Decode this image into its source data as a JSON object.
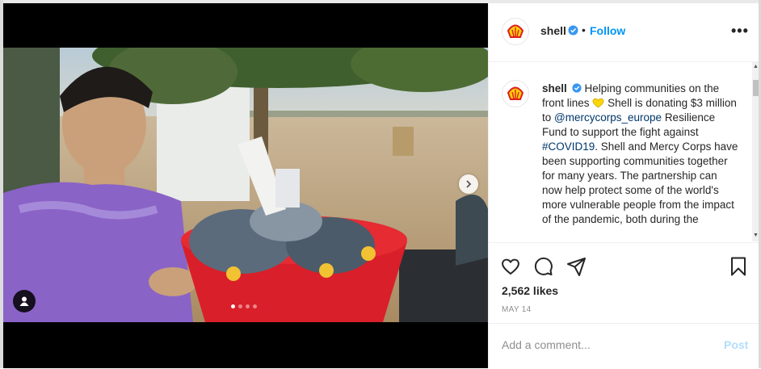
{
  "post": {
    "author": {
      "username": "shell",
      "verified": true,
      "avatar": "shell-logo-icon"
    },
    "follow_separator": "•",
    "follow_label": "Follow",
    "more_label": "•••",
    "caption": {
      "part1": "Helping communities on the front lines",
      "part2": "Shell is donating $3 million to",
      "mention": "@mercycorps_europe",
      "part3": "Resilience Fund to support the fight against",
      "hashtag": "#COVID19",
      "part4": ". Shell and Mercy Corps have been supporting communities together for many years. The partnership can now help protect some of the world's more vulnerable people from the impact of the pandemic, both during the"
    },
    "likes": "2,562 likes",
    "date": "MAY 14",
    "comment_placeholder": "Add a comment...",
    "post_label": "Post",
    "carousel": {
      "slides": 4,
      "active_index": 0
    }
  },
  "colors": {
    "accent": "#0095f6",
    "post_disabled": "#b2dffc",
    "shell_red": "#dd1d21",
    "shell_yellow": "#fbce07",
    "verified_blue": "#3897f0"
  },
  "icons": {
    "like": "heart-outline-icon",
    "comment": "comment-bubble-icon",
    "share": "paper-plane-icon",
    "save": "bookmark-icon",
    "next": "chevron-right-icon",
    "tags": "user-tag-icon"
  }
}
